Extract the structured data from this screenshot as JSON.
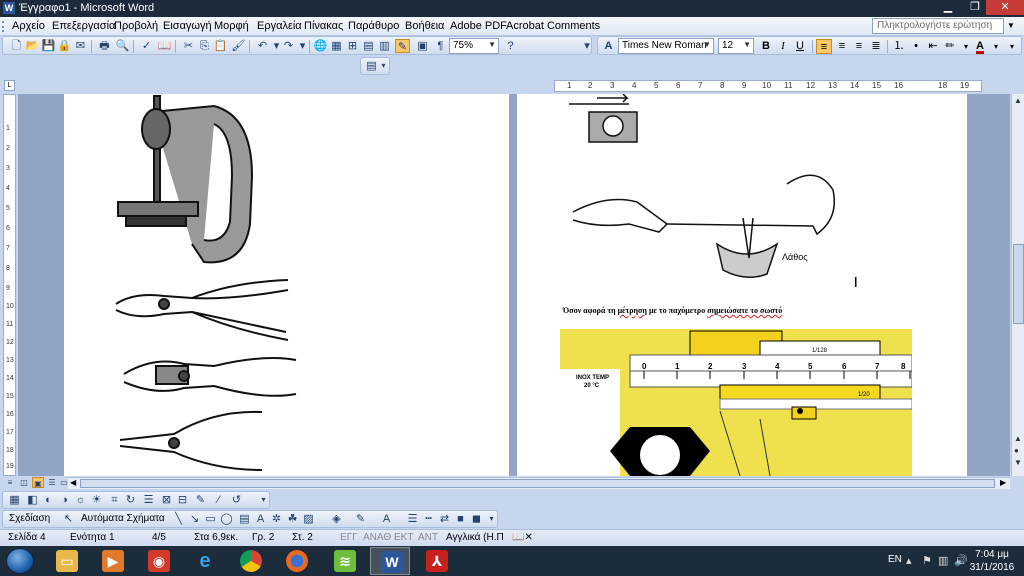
{
  "window": {
    "title": "Έγγραφο1 - Microsoft Word",
    "app_icon": "W",
    "controls": [
      "minimize-icon",
      "restore-icon",
      "close-icon"
    ]
  },
  "menu": {
    "items": [
      "Αρχείο",
      "Επεξεργασία",
      "Προβολή",
      "Εισαγωγή",
      "Μορφή",
      "Εργαλεία",
      "Πίνακας",
      "Παράθυρο",
      "Βοήθεια",
      "Adobe PDF",
      "Acrobat Comments"
    ],
    "ask_placeholder": "Πληκτρολογήστε ερώτηση"
  },
  "standard_toolbar": {
    "zoom": "75%",
    "pilcrow": "¶"
  },
  "formatting_toolbar": {
    "style_icon": "A",
    "font": "Times New Roman",
    "size": "12",
    "bold": "B",
    "italic": "I",
    "underline": "U"
  },
  "ruler": {
    "labels": [
      "1",
      "2",
      "3",
      "4",
      "5",
      "6",
      "7",
      "8",
      "9",
      "10",
      "11",
      "12",
      "13",
      "14",
      "15",
      "16",
      "18",
      "19"
    ]
  },
  "vertical_ruler": {
    "labels": [
      "1",
      "2",
      "3",
      "4",
      "5",
      "6",
      "7",
      "8",
      "9",
      "10",
      "11",
      "12",
      "13",
      "14",
      "15",
      "16",
      "17",
      "18",
      "19"
    ]
  },
  "document": {
    "caption_before": "Όσον αφορά τη ",
    "caption_word1": "μέτρηση",
    "caption_mid": " με το παχύμετρο ",
    "caption_word2": "σημειώσατε το σωστό",
    "wrong_label": "Λάθος",
    "vernier": {
      "left_label": "INOX TEMP",
      "left_sub": "20 °C",
      "main_scale": [
        "0",
        "1",
        "2",
        "3",
        "4",
        "5",
        "6",
        "7",
        "8"
      ],
      "top_scale_label": "1/128",
      "bottom_scale_label": "1/20"
    }
  },
  "drawing_toolbar": {
    "draw_label": "Σχεδίαση",
    "autoshapes_label": "Αυτόματα Σχήματα"
  },
  "statusbar": {
    "page": "Σελίδα 4",
    "section": "Ενότητα 1",
    "pages": "4/5",
    "at": "Στα 6,9εκ.",
    "line": "Γρ. 2",
    "col": "Στ. 2",
    "rec": "ΕΓΓ",
    "trk": "ΑΝΑΘ",
    "ext": "ΕΚΤ",
    "ovr": "ΑΝΤ",
    "language": "Αγγλικά (Η.Π"
  },
  "taskbar": {
    "apps": [
      "explorer-icon",
      "media-player-icon",
      "camera-icon",
      "internet-explorer-icon",
      "chrome-icon",
      "firefox-icon",
      "bluestacks-icon",
      "word-icon",
      "acrobat-icon"
    ],
    "language": "EN",
    "time": "7:04 μμ",
    "date": "31/1/2016"
  }
}
